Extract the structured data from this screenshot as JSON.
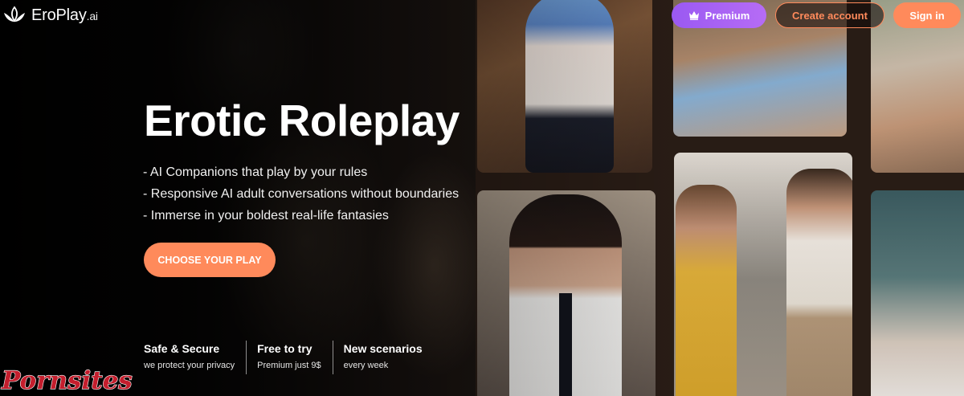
{
  "logo": {
    "name": "EroPlay",
    "suffix": ".ai"
  },
  "nav": {
    "premium_label": "Premium",
    "create_label": "Create account",
    "signin_label": "Sign in"
  },
  "hero": {
    "title": "Erotic Roleplay",
    "features": [
      "- AI Companions that play by your rules",
      "- Responsive AI adult conversations without boundaries",
      "- Immerse in your boldest real-life fantasies"
    ],
    "cta_label": "CHOOSE YOUR PLAY"
  },
  "badges": [
    {
      "title": "Safe & Secure",
      "subtitle": "we protect your privacy"
    },
    {
      "title": "Free to try",
      "subtitle": "Premium just 9$"
    },
    {
      "title": "New scenarios",
      "subtitle": "every week"
    }
  ],
  "watermark": {
    "text": "Pornsites",
    "color": "#c41e2d"
  },
  "colors": {
    "accent": "#ff8a5b",
    "premium": "#a35ff3",
    "background": "#0b0908"
  },
  "icons": {
    "logo": "lotus-logo-icon",
    "premium": "crown-icon"
  }
}
